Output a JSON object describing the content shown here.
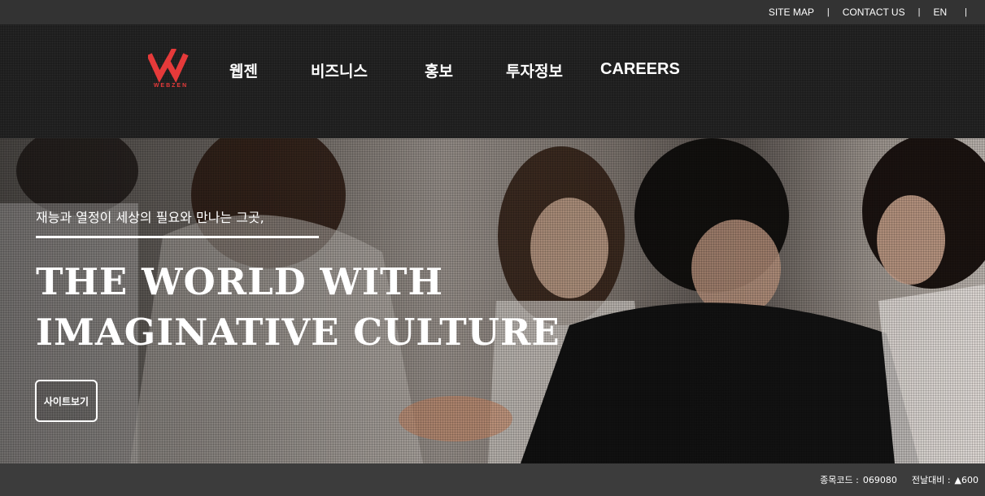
{
  "utility_nav": {
    "items": [
      "SITE MAP",
      "CONTACT US",
      "EN"
    ]
  },
  "logo": {
    "wordmark": "WEBZEN"
  },
  "gnb": {
    "items": [
      "웹젠",
      "비즈니스",
      "홍보",
      "투자정보",
      "CAREERS"
    ]
  },
  "hero": {
    "subtitle": "재능과 열정이 세상의 필요와 만나는 그곳,",
    "title_line1": "THE WORLD WITH",
    "title_line2": "IMAGINATIVE CULTURE",
    "button_label": "사이트보기"
  },
  "stock": {
    "code_label": "종목코드 :",
    "code_value": "069080",
    "change_label": "전날대비 :",
    "change_value": "▲600"
  },
  "colors": {
    "brand_red": "#e63a3a",
    "header_bg": "#1b1b1b",
    "util_bg": "#333333",
    "stock_bg": "#3c3c3c"
  }
}
